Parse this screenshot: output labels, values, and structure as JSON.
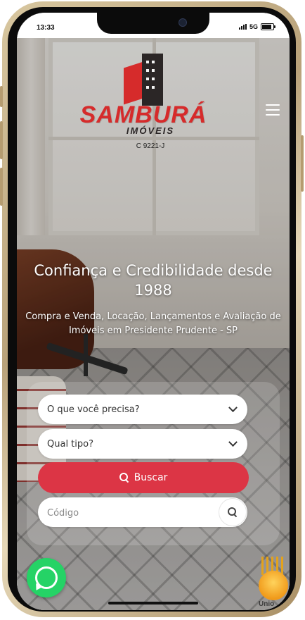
{
  "status_bar": {
    "time": "13:33",
    "network": "5G"
  },
  "brand": {
    "name": "SAMBURÁ",
    "subtitle": "IMÓVEIS",
    "creci": "C 9221-J"
  },
  "colors": {
    "brand_red": "#d62b2b",
    "button_red": "#dc3545",
    "whatsapp_green": "#25d366"
  },
  "hero": {
    "headline": "Confiança e Credibilidade desde 1988",
    "subheadline": "Compra e Venda, Locação, Lançamentos e Avaliação de Imóveis em Presidente Prudente - SP"
  },
  "search": {
    "need_select": {
      "label": "O que você precisa?",
      "icon": "chevron-down-icon"
    },
    "type_select": {
      "label": "Qual tipo?",
      "icon": "chevron-down-icon"
    },
    "submit": {
      "label": "Buscar",
      "icon": "search-icon"
    },
    "code_input": {
      "placeholder": "Código",
      "value": "",
      "icon": "search-icon"
    }
  },
  "floating": {
    "whatsapp_icon": "whatsapp-icon",
    "union_label": "Unio"
  }
}
